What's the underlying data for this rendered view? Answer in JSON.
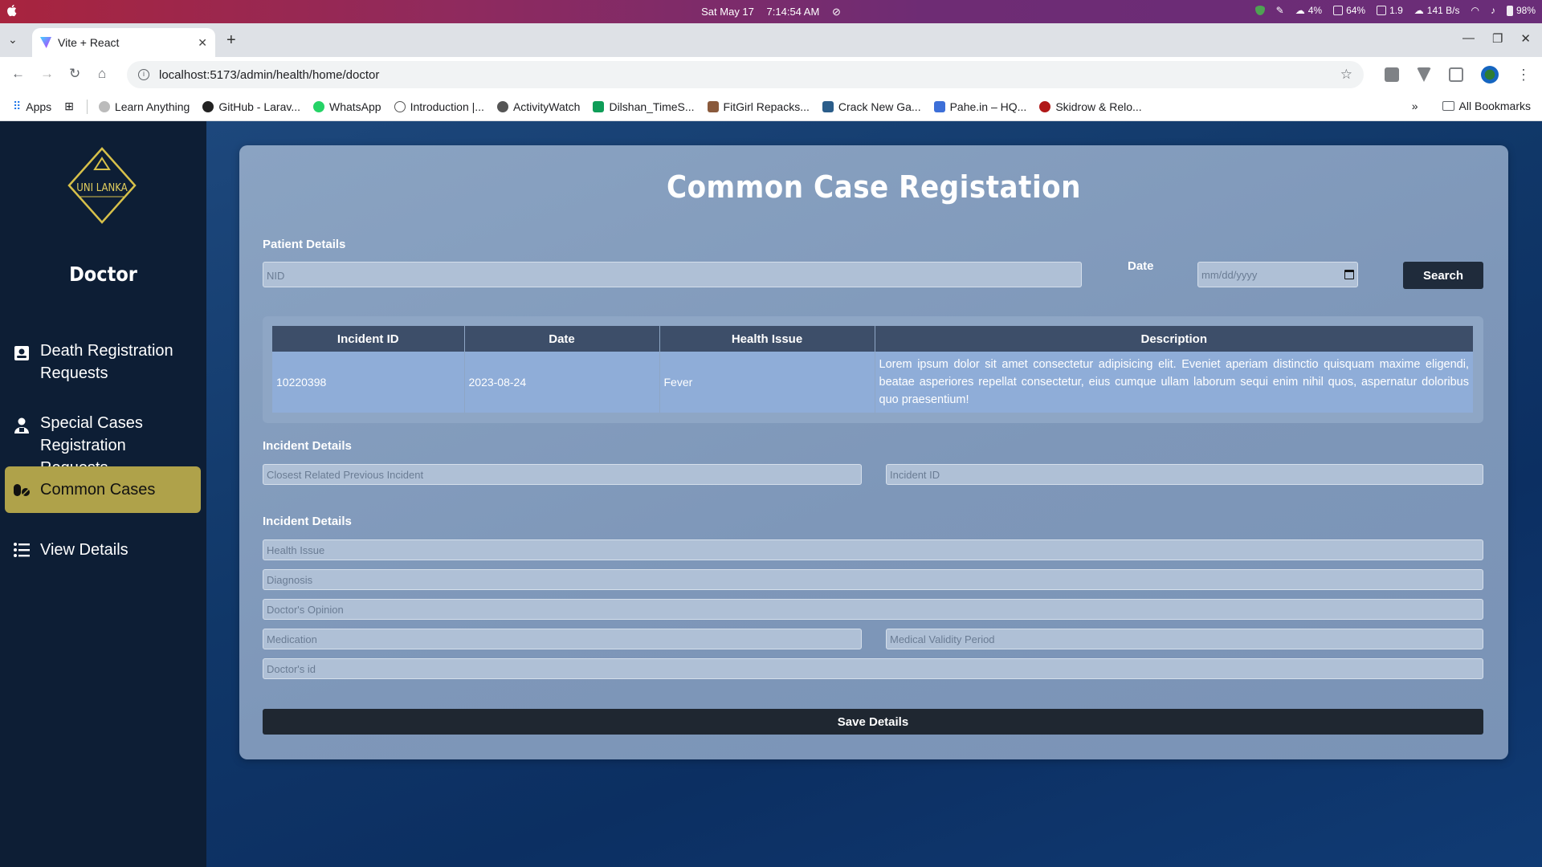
{
  "os": {
    "date": "Sat May 17",
    "time": "7:14:54 AM",
    "status": [
      "4%",
      "64%",
      "1.9",
      "141 B/s",
      "98%"
    ]
  },
  "browser": {
    "tab_title": "Vite + React",
    "url": "localhost:5173/admin/health/home/doctor",
    "bookmarks": [
      "Apps",
      "Learn Anything",
      "GitHub - Larav...",
      "WhatsApp",
      "Introduction |...",
      "ActivityWatch",
      "Dilshan_TimeS...",
      "FitGirl Repacks...",
      "Crack New Ga...",
      "Pahe.in – HQ...",
      "Skidrow & Relo..."
    ],
    "all_bookmarks": "All Bookmarks"
  },
  "sidebar": {
    "logo_text": "UNI LANKA",
    "role": "Doctor",
    "items": [
      {
        "label": "Death Registration Requests"
      },
      {
        "label": "Special Cases Registration Requests"
      },
      {
        "label": "Common Cases"
      },
      {
        "label": "View Details"
      }
    ]
  },
  "form": {
    "title": "Common Case Registation",
    "patient_details_label": "Patient Details",
    "nid_placeholder": "NID",
    "date_label": "Date",
    "date_placeholder": "mm/dd/yyyy",
    "search_label": "Search",
    "table": {
      "headers": [
        "Incident ID",
        "Date",
        "Health Issue",
        "Description"
      ],
      "rows": [
        [
          "10220398",
          "2023-08-24",
          "Fever",
          "Lorem ipsum dolor sit amet consectetur adipisicing elit. Eveniet aperiam distinctio quisquam maxime eligendi, beatae asperiores repellat consectetur, eius cumque ullam laborum sequi enim nihil quos, aspernatur doloribus quo praesentium!"
        ]
      ]
    },
    "incident_section_1": "Incident Details",
    "closest_incident_placeholder": "Closest Related Previous Incident",
    "incident_id_placeholder": "Incident ID",
    "incident_section_2": "Incident Details",
    "health_issue_placeholder": "Health Issue",
    "diagnosis_placeholder": "Diagnosis",
    "doctors_opinion_placeholder": "Doctor's Opinion",
    "medication_placeholder": "Medication",
    "validity_placeholder": "Medical Validity Period",
    "doctor_id_placeholder": "Doctor's id",
    "save_label": "Save Details"
  }
}
